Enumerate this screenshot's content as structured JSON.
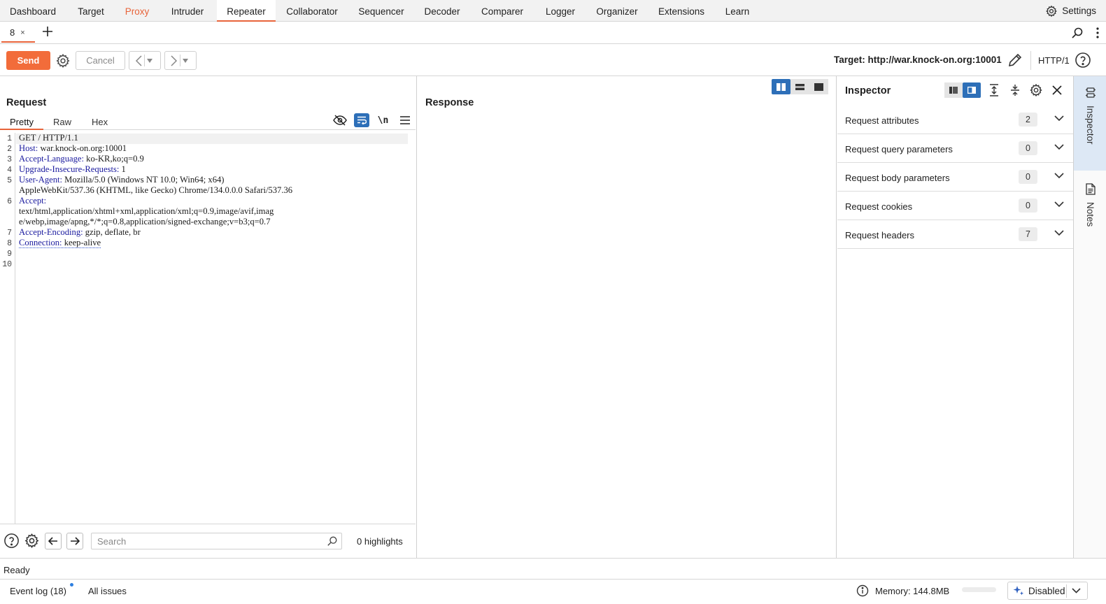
{
  "nav": {
    "tabs": [
      "Dashboard",
      "Target",
      "Proxy",
      "Intruder",
      "Repeater",
      "Collaborator",
      "Sequencer",
      "Decoder",
      "Comparer",
      "Logger",
      "Organizer",
      "Extensions",
      "Learn"
    ],
    "active": "Repeater",
    "settings_label": "Settings"
  },
  "subtabs": {
    "request_tab_label": "8",
    "close_glyph": "×"
  },
  "toolbar": {
    "send_label": "Send",
    "cancel_label": "Cancel",
    "target_label": "Target: http://war.knock-on.org:10001",
    "http_version": "HTTP/1"
  },
  "request": {
    "title": "Request",
    "view_tabs": [
      "Pretty",
      "Raw",
      "Hex"
    ],
    "active_view": "Pretty",
    "newline_toggle": "\\n",
    "line_numbers": [
      "1",
      "2",
      "3",
      "4",
      "5",
      "6",
      "7",
      "8",
      "9",
      "10"
    ],
    "lines": [
      {
        "plain": "GET / HTTP/1.1"
      },
      {
        "key": "Host:",
        "val": " war.knock-on.org:10001"
      },
      {
        "key": "Accept-Language:",
        "val": " ko-KR,ko;q=0.9"
      },
      {
        "key": "Upgrade-Insecure-Requests:",
        "val": " 1"
      },
      {
        "key": "User-Agent:",
        "val": " Mozilla/5.0 (Windows NT 10.0; Win64; x64)"
      },
      {
        "plain": "AppleWebKit/537.36 (KHTML, like Gecko) Chrome/134.0.0.0 Safari/537.36"
      },
      {
        "key": "Accept:",
        "val": ""
      },
      {
        "plain": "text/html,application/xhtml+xml,application/xml;q=0.9,image/avif,imag"
      },
      {
        "plain": "e/webp,image/apng,*/*;q=0.8,application/signed-exchange;v=b3;q=0.7"
      },
      {
        "key": "Accept-Encoding:",
        "val": " gzip, deflate, br"
      },
      {
        "key": "Connection:",
        "val": " keep-alive"
      }
    ],
    "search_placeholder": "Search",
    "highlights_label": "0 highlights"
  },
  "response": {
    "title": "Response"
  },
  "inspector": {
    "title": "Inspector",
    "sections": [
      {
        "label": "Request attributes",
        "count": "2"
      },
      {
        "label": "Request query parameters",
        "count": "0"
      },
      {
        "label": "Request body parameters",
        "count": "0"
      },
      {
        "label": "Request cookies",
        "count": "0"
      },
      {
        "label": "Request headers",
        "count": "7"
      }
    ]
  },
  "sidebar": {
    "tabs": [
      "Inspector",
      "Notes"
    ]
  },
  "status": {
    "ready": "Ready",
    "event_log": "Event log (18)",
    "all_issues": "All issues",
    "memory": "Memory: 144.8MB",
    "ai_state": "Disabled"
  },
  "colors": {
    "accent": "#e8643a",
    "send": "#f26c3a",
    "active_blue": "#2d6fb8",
    "header_key": "#1a1a9e"
  }
}
